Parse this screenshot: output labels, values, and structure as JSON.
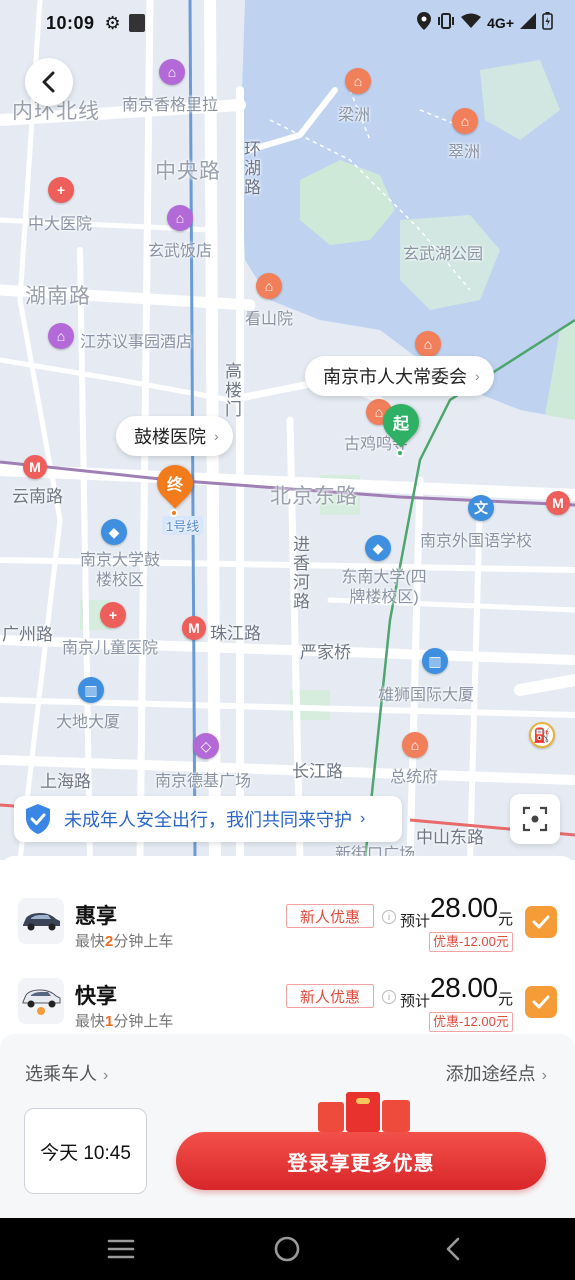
{
  "status_bar": {
    "time": "10:09",
    "network": "4G+",
    "icons": [
      "gear-icon",
      "sd-card-icon",
      "location-icon",
      "vibrate-icon",
      "wifi-icon",
      "signal-icon",
      "battery-icon"
    ]
  },
  "map": {
    "labels": [
      {
        "text": "内环北线",
        "style": "big"
      },
      {
        "text": "南京香格里拉",
        "style": "small"
      },
      {
        "text": "中央路",
        "style": "big"
      },
      {
        "text": "环湖路",
        "style": "road"
      },
      {
        "text": "梁洲",
        "style": "small"
      },
      {
        "text": "翠洲",
        "style": "small"
      },
      {
        "text": "中大医院",
        "style": "small"
      },
      {
        "text": "玄武饭店",
        "style": "small"
      },
      {
        "text": "玄武湖公园",
        "style": "small"
      },
      {
        "text": "湖南路",
        "style": "big"
      },
      {
        "text": "江苏议事园酒店",
        "style": "small"
      },
      {
        "text": "看山院",
        "style": "small"
      },
      {
        "text": "高楼门",
        "style": "road"
      },
      {
        "text": "古鸡鸣寺",
        "style": "small"
      },
      {
        "text": "云南路",
        "style": "road"
      },
      {
        "text": "北京东路",
        "style": "big"
      },
      {
        "text": "1号线",
        "style": "small"
      },
      {
        "text": "南京外国语学校",
        "style": "small"
      },
      {
        "text": "南京大学鼓楼校区",
        "style": "small"
      },
      {
        "text": "进香河路",
        "style": "road"
      },
      {
        "text": "东南大学(四牌楼校区)",
        "style": "small"
      },
      {
        "text": "广州路",
        "style": "road"
      },
      {
        "text": "珠江路",
        "style": "road"
      },
      {
        "text": "南京儿童医院",
        "style": "small"
      },
      {
        "text": "严家桥",
        "style": "road"
      },
      {
        "text": "雄狮国际大厦",
        "style": "small"
      },
      {
        "text": "大地大厦",
        "style": "small"
      },
      {
        "text": "上海路",
        "style": "road"
      },
      {
        "text": "南京德基广场",
        "style": "small"
      },
      {
        "text": "长江路",
        "style": "road"
      },
      {
        "text": "总统府",
        "style": "small"
      },
      {
        "text": "中山东路",
        "style": "road"
      },
      {
        "text": "新街口广场",
        "style": "small"
      }
    ],
    "start_callout": "南京市人大常委会",
    "end_callout": "鼓楼医院",
    "start_pin": "起",
    "end_pin": "终"
  },
  "safety_banner": {
    "text": "未成年人安全出行，我们共同来守护"
  },
  "rides": [
    {
      "name": "惠享",
      "eta_prefix": "最快",
      "eta_minutes": "2",
      "eta_suffix": "分钟上车",
      "promo": "新人优惠",
      "estimate_label": "预计",
      "price": "28.00",
      "unit": "元",
      "discount": "优惠-12.00元",
      "checked": true
    },
    {
      "name": "快享",
      "eta_prefix": "最快",
      "eta_minutes": "1",
      "eta_suffix": "分钟上车",
      "promo": "新人优惠",
      "estimate_label": "预计",
      "price": "28.00",
      "unit": "元",
      "discount": "优惠-12.00元",
      "checked": true
    }
  ],
  "options": {
    "passenger": "选乘车人",
    "waypoint": "添加途经点",
    "time": "今天 10:45",
    "login_button": "登录享更多优惠"
  },
  "colors": {
    "accent_orange": "#f59b38",
    "promo_red": "#e24a3b",
    "login_red": "#d8262a",
    "safety_blue": "#2b66c8",
    "start_green": "#2eb065",
    "end_orange": "#f27c1c"
  }
}
